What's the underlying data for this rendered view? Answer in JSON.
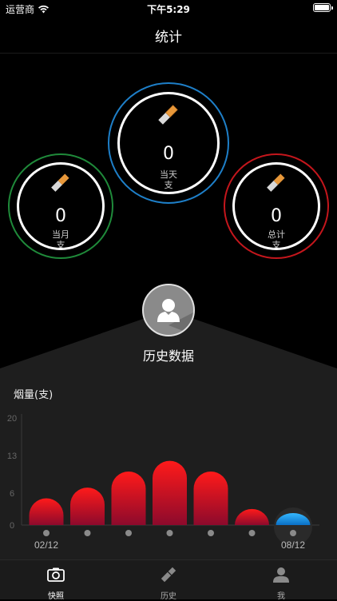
{
  "status_bar": {
    "carrier": "运营商",
    "time": "下午5:29"
  },
  "nav": {
    "title": "统计"
  },
  "gauges": {
    "today": {
      "value": "0",
      "label": "当天",
      "unit": "支",
      "ring_color": "#1e7fc8"
    },
    "month": {
      "value": "0",
      "label": "当月",
      "unit": "支",
      "ring_color": "#1f8a3a"
    },
    "total": {
      "value": "0",
      "label": "总计",
      "unit": "支",
      "ring_color": "#c4161c"
    }
  },
  "history": {
    "label": "历史数据"
  },
  "chart_data": {
    "type": "bar",
    "title": "烟量(支)",
    "y_ticks": [
      "20",
      "13",
      "6",
      "0"
    ],
    "ylim": [
      0,
      20
    ],
    "categories": [
      "02/12",
      "",
      "",
      "",
      "",
      "",
      "08/12"
    ],
    "x_labels_shown": [
      "02/12",
      "08/12"
    ],
    "values": [
      5,
      7,
      10,
      12,
      10,
      3,
      0
    ],
    "bar_colors": {
      "top": "#ff1a1a",
      "bottom": "#8c0a2c",
      "current": "#1e9ee8"
    }
  },
  "tabs": [
    {
      "label": "快照",
      "icon": "camera-icon",
      "active": true
    },
    {
      "label": "历史",
      "icon": "cigarette-icon",
      "active": false
    },
    {
      "label": "我",
      "icon": "person-icon",
      "active": false
    }
  ]
}
